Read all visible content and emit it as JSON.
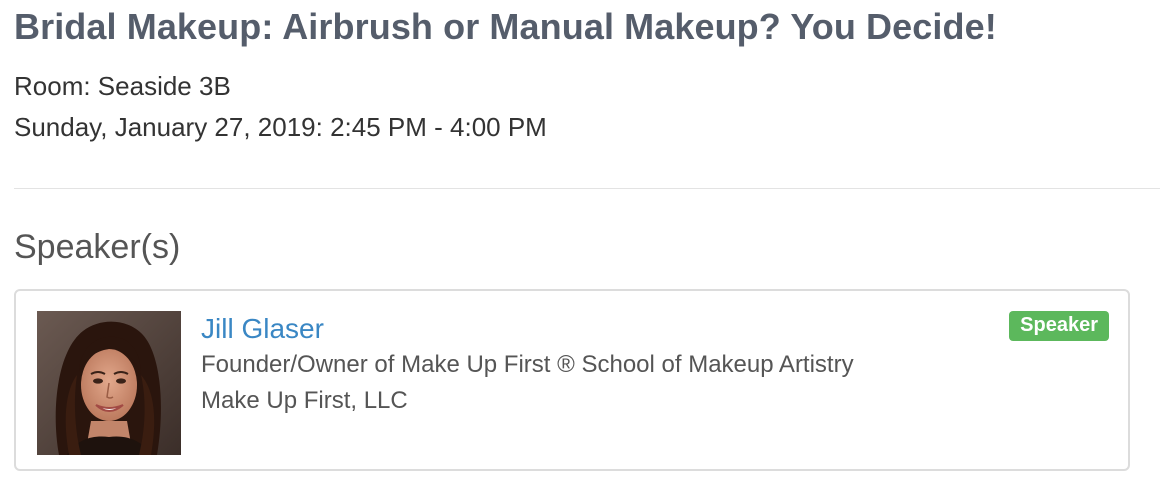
{
  "session": {
    "title": "Bridal Makeup: Airbrush or Manual Makeup? You Decide!",
    "room": "Room: Seaside 3B",
    "datetime": "Sunday, January 27, 2019: 2:45 PM - 4:00 PM"
  },
  "speakers_section": {
    "heading": "Speaker(s)",
    "speakers": [
      {
        "name": "Jill Glaser",
        "title": "Founder/Owner of Make Up First ® School of Makeup Artistry",
        "company": "Make Up First, LLC",
        "role_badge": "Speaker",
        "badge_color": "#5cb85c",
        "name_link_color": "#3a87c4"
      }
    ]
  }
}
